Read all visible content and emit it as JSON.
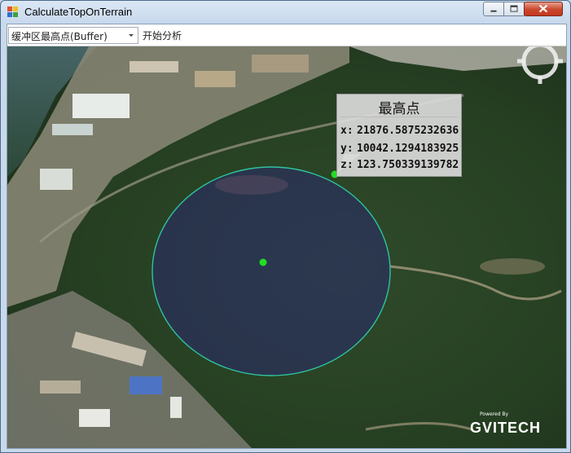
{
  "window": {
    "title": "CalculateTopOnTerrain",
    "buttons": {
      "minimize": "minimize-icon",
      "maximize": "maximize-icon",
      "close": "close-icon"
    }
  },
  "toolbar": {
    "mode_select_value": "缓冲区最高点(Buffer)",
    "start_analysis_label": "开始分析"
  },
  "callout": {
    "title": "最高点",
    "x_label": "x:",
    "x_value": "21876.5875232636",
    "y_label": "y:",
    "y_value": "10042.1294183925",
    "z_label": "z:",
    "z_value": "123.750339139782"
  },
  "brand": {
    "powered_by": "Powered By",
    "logo_text": "GVITECH"
  },
  "colors": {
    "buffer_fill": "#2a2a6e",
    "buffer_stroke": "#2ec4a0",
    "point_color": "#22dd22",
    "close_button": "#c9462c"
  }
}
